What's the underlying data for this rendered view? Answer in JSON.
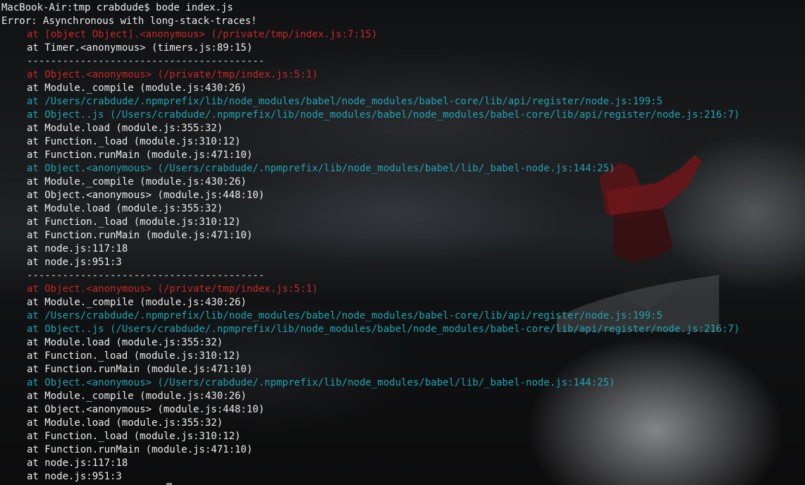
{
  "window": {
    "prompt_line": "MacBook-Air:tmp crabdude$ bode index.js"
  },
  "output": {
    "error_header": "Error: Asynchronous with long-stack-traces!",
    "lines": [
      {
        "text": "at [object Object].<anonymous> (/private/tmp/index.js:7:15)",
        "color": "#c8282a"
      },
      {
        "text": "at Timer.<anonymous> (timers.js:89:15)",
        "color": "#ececec"
      },
      {
        "text": "----------------------------------------",
        "color": "#cfcfcf"
      },
      {
        "text": "at Object.<anonymous> (/private/tmp/index.js:5:1)",
        "color": "#c8282a"
      },
      {
        "text": "at Module._compile (module.js:430:26)",
        "color": "#ececec"
      },
      {
        "text": "at /Users/crabdude/.npmprefix/lib/node_modules/babel/node_modules/babel-core/lib/api/register/node.js:199:5",
        "color": "#1fa5b5"
      },
      {
        "text": "at Object..js (/Users/crabdude/.npmprefix/lib/node_modules/babel/node_modules/babel-core/lib/api/register/node.js:216:7)",
        "color": "#1fa5b5"
      },
      {
        "text": "at Module.load (module.js:355:32)",
        "color": "#ececec"
      },
      {
        "text": "at Function._load (module.js:310:12)",
        "color": "#ececec"
      },
      {
        "text": "at Function.runMain (module.js:471:10)",
        "color": "#ececec"
      },
      {
        "text": "at Object.<anonymous> (/Users/crabdude/.npmprefix/lib/node_modules/babel/lib/_babel-node.js:144:25)",
        "color": "#1fa5b5"
      },
      {
        "text": "at Module._compile (module.js:430:26)",
        "color": "#ececec"
      },
      {
        "text": "at Object.<anonymous> (module.js:448:10)",
        "color": "#ececec"
      },
      {
        "text": "at Module.load (module.js:355:32)",
        "color": "#ececec"
      },
      {
        "text": "at Function._load (module.js:310:12)",
        "color": "#ececec"
      },
      {
        "text": "at Function.runMain (module.js:471:10)",
        "color": "#ececec"
      },
      {
        "text": "at node.js:117:18",
        "color": "#ececec"
      },
      {
        "text": "at node.js:951:3",
        "color": "#ececec"
      },
      {
        "text": "----------------------------------------",
        "color": "#cfcfcf"
      },
      {
        "text": "at Object.<anonymous> (/private/tmp/index.js:5:1)",
        "color": "#c8282a"
      },
      {
        "text": "at Module._compile (module.js:430:26)",
        "color": "#ececec"
      },
      {
        "text": "at /Users/crabdude/.npmprefix/lib/node_modules/babel/node_modules/babel-core/lib/api/register/node.js:199:5",
        "color": "#1fa5b5"
      },
      {
        "text": "at Object..js (/Users/crabdude/.npmprefix/lib/node_modules/babel/node_modules/babel-core/lib/api/register/node.js:216:7)",
        "color": "#1fa5b5"
      },
      {
        "text": "at Module.load (module.js:355:32)",
        "color": "#ececec"
      },
      {
        "text": "at Function._load (module.js:310:12)",
        "color": "#ececec"
      },
      {
        "text": "at Function.runMain (module.js:471:10)",
        "color": "#ececec"
      },
      {
        "text": "at Object.<anonymous> (/Users/crabdude/.npmprefix/lib/node_modules/babel/lib/_babel-node.js:144:25)",
        "color": "#1fa5b5"
      },
      {
        "text": "at Module._compile (module.js:430:26)",
        "color": "#ececec"
      },
      {
        "text": "at Object.<anonymous> (module.js:448:10)",
        "color": "#ececec"
      },
      {
        "text": "at Module.load (module.js:355:32)",
        "color": "#ececec"
      },
      {
        "text": "at Function._load (module.js:310:12)",
        "color": "#ececec"
      },
      {
        "text": "at Function.runMain (module.js:471:10)",
        "color": "#ececec"
      },
      {
        "text": "at node.js:117:18",
        "color": "#ececec"
      },
      {
        "text": "at node.js:951:3",
        "color": "#ececec"
      }
    ]
  },
  "colors": {
    "text": "#ececec",
    "error_frame": "#c8282a",
    "babel_frame": "#1fa5b5",
    "separator": "#cfcfcf"
  }
}
